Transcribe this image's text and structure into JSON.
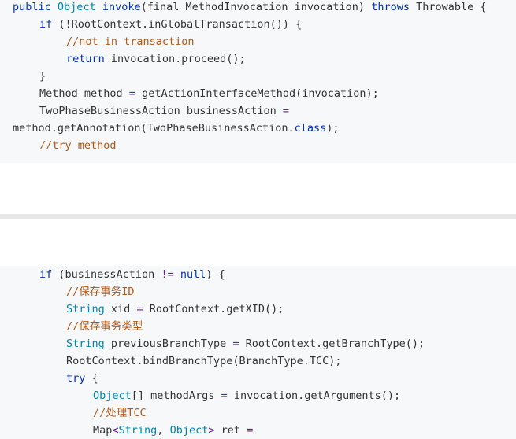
{
  "block1": {
    "lines": [
      {
        "indent": 0,
        "tokens": [
          {
            "t": "public ",
            "c": "kw"
          },
          {
            "t": "Object ",
            "c": "tp"
          },
          {
            "t": "invoke",
            "c": "kw"
          },
          {
            "t": "(final MethodInvocation invocation) ",
            "c": "fn"
          },
          {
            "t": "throws",
            "c": "kw"
          },
          {
            "t": " Throwable {",
            "c": "fn"
          }
        ]
      },
      {
        "indent": 1,
        "tokens": [
          {
            "t": "if ",
            "c": "kw"
          },
          {
            "t": "(!RootContext.inGlobalTransaction()) {",
            "c": "fn"
          }
        ]
      },
      {
        "indent": 2,
        "tokens": [
          {
            "t": "//not in transaction",
            "c": "cm"
          }
        ]
      },
      {
        "indent": 2,
        "tokens": [
          {
            "t": "return ",
            "c": "kw"
          },
          {
            "t": "invocation.proceed();",
            "c": "fn"
          }
        ]
      },
      {
        "indent": 1,
        "tokens": [
          {
            "t": "}",
            "c": "fn"
          }
        ]
      },
      {
        "indent": 1,
        "tokens": [
          {
            "t": "Method method ",
            "c": "fn"
          },
          {
            "t": "=",
            "c": "op"
          },
          {
            "t": " getActionInterfaceMethod(invocation);",
            "c": "fn"
          }
        ]
      },
      {
        "indent": 1,
        "tokens": [
          {
            "t": "TwoPhaseBusinessAction businessAction ",
            "c": "fn"
          },
          {
            "t": "=",
            "c": "op"
          }
        ]
      },
      {
        "indent": 0,
        "tokens": [
          {
            "t": "method.getAnnotation(TwoPhaseBusinessAction.",
            "c": "fn"
          },
          {
            "t": "class",
            "c": "kw"
          },
          {
            "t": ");",
            "c": "fn"
          }
        ]
      },
      {
        "indent": 1,
        "tokens": [
          {
            "t": "//try method",
            "c": "cm"
          }
        ]
      }
    ]
  },
  "block2": {
    "lines": [
      {
        "indent": 1,
        "tokens": [
          {
            "t": "if ",
            "c": "kw"
          },
          {
            "t": "(businessAction ",
            "c": "fn"
          },
          {
            "t": "!=",
            "c": "op"
          },
          {
            "t": " ",
            "c": "fn"
          },
          {
            "t": "null",
            "c": "nl"
          },
          {
            "t": ") {",
            "c": "fn"
          }
        ]
      },
      {
        "indent": 2,
        "tokens": [
          {
            "t": "//保存事务ID",
            "c": "cm"
          }
        ]
      },
      {
        "indent": 2,
        "tokens": [
          {
            "t": "String ",
            "c": "tp"
          },
          {
            "t": "xid ",
            "c": "fn"
          },
          {
            "t": "=",
            "c": "op"
          },
          {
            "t": " RootContext.getXID();",
            "c": "fn"
          }
        ]
      },
      {
        "indent": 2,
        "tokens": [
          {
            "t": "//保存事务类型",
            "c": "cm"
          }
        ]
      },
      {
        "indent": 2,
        "tokens": [
          {
            "t": "String ",
            "c": "tp"
          },
          {
            "t": "previousBranchType ",
            "c": "fn"
          },
          {
            "t": "=",
            "c": "op"
          },
          {
            "t": " RootContext.getBranchType();",
            "c": "fn"
          }
        ]
      },
      {
        "indent": 2,
        "tokens": [
          {
            "t": "RootContext.bindBranchType(BranchType.TCC);",
            "c": "fn"
          }
        ]
      },
      {
        "indent": 2,
        "tokens": [
          {
            "t": "try ",
            "c": "kw"
          },
          {
            "t": "{",
            "c": "fn"
          }
        ]
      },
      {
        "indent": 3,
        "tokens": [
          {
            "t": "Object",
            "c": "tp"
          },
          {
            "t": "[] methodArgs ",
            "c": "fn"
          },
          {
            "t": "=",
            "c": "op"
          },
          {
            "t": " invocation.getArguments();",
            "c": "fn"
          }
        ]
      },
      {
        "indent": 3,
        "tokens": [
          {
            "t": "//处理TCC",
            "c": "cm"
          }
        ]
      },
      {
        "indent": 3,
        "tokens": [
          {
            "t": "Map",
            "c": "fn"
          },
          {
            "t": "<",
            "c": "op"
          },
          {
            "t": "String",
            "c": "tp"
          },
          {
            "t": ", ",
            "c": "fn"
          },
          {
            "t": "Object",
            "c": "tp"
          },
          {
            "t": "> ",
            "c": "op"
          },
          {
            "t": "ret ",
            "c": "fn"
          },
          {
            "t": "=",
            "c": "op"
          }
        ]
      }
    ]
  }
}
